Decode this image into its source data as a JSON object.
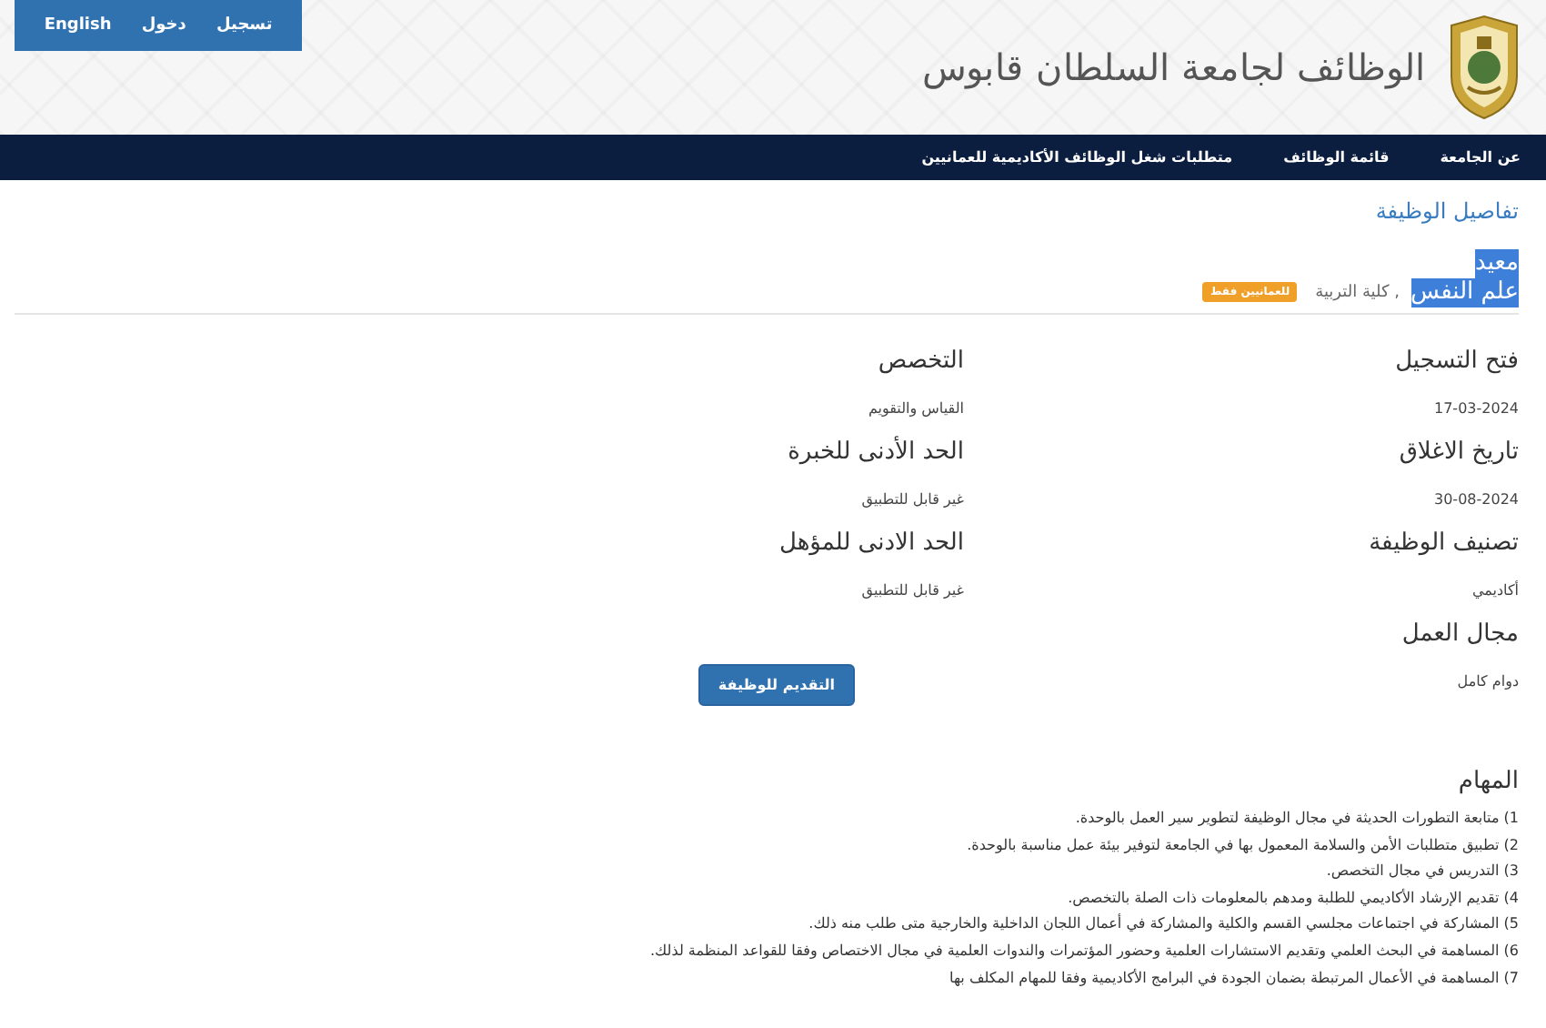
{
  "top_links": [
    "تسجيل",
    "دخول",
    "English"
  ],
  "site_title": "الوظائف لجامعة السلطان قابوس",
  "nav": [
    "عن الجامعة",
    "قائمة الوظائف",
    "متطلبات شغل الوظائف الأكاديمية للعمانيين"
  ],
  "page_heading": "تفاصيل الوظيفة",
  "job": {
    "title_lines": [
      "معيد",
      "علم النفس"
    ],
    "selected": true,
    "college": ", كلية التربية",
    "badge": "للعمانيين فقط"
  },
  "details_right": [
    {
      "label": "فتح التسجيل",
      "value": "17-03-2024"
    },
    {
      "label": "تاريخ الاغلاق",
      "value": "30-08-2024"
    },
    {
      "label": "تصنيف الوظيفة",
      "value": "أكاديمي"
    },
    {
      "label": "مجال العمل",
      "value": "دوام كامل"
    }
  ],
  "details_left": [
    {
      "label": "التخصص",
      "value": "القياس والتقويم"
    },
    {
      "label": "الحد الأدنى للخبرة",
      "value": "غير قابل للتطبيق"
    },
    {
      "label": "الحد الادنى للمؤهل",
      "value": "غير قابل للتطبيق"
    }
  ],
  "apply_button": "التقديم للوظيفة",
  "tasks_heading": "المهام",
  "tasks": [
    "1) متابعة التطورات الحديثة في مجال الوظيفة لتطوير سير العمل بالوحدة.",
    "2) تطبيق متطلبات الأمن والسلامة المعمول بها في الجامعة لتوفير بيئة عمل مناسبة بالوحدة.",
    "3) التدريس في مجال التخصص.",
    "4) تقديم الإرشاد الأكاديمي للطلبة ومدهم بالمعلومات ذات الصلة بالتخصص.",
    "5) المشاركة في اجتماعات مجلسي القسم والكلية والمشاركة في أعمال اللجان الداخلية والخارجية متى طلب منه ذلك.",
    "6) المساهمة في البحث العلمي وتقديم الاستشارات العلمية وحضور المؤتمرات والندوات العلمية في مجال الاختصاص وفقا للقواعد المنظمة لذلك.",
    "7) المساهمة في الأعمال المرتبطة بضمان الجودة في البرامج الأكاديمية وفقا للمهام المكلف بها"
  ]
}
